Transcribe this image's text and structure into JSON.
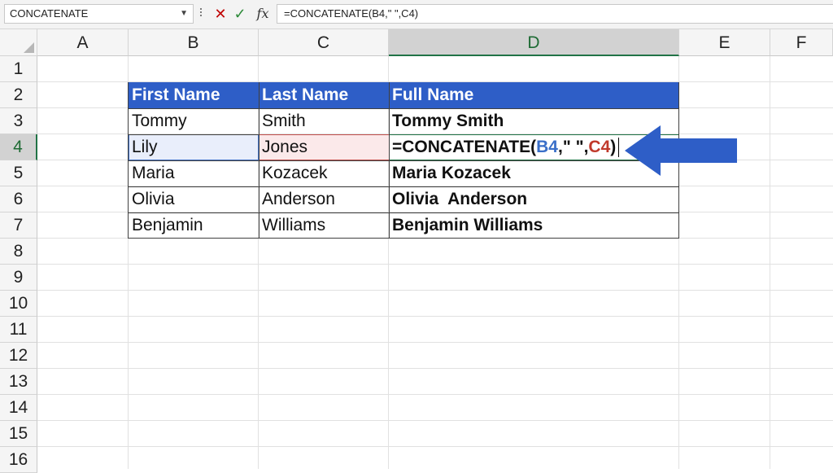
{
  "name_box": {
    "value": "CONCATENATE"
  },
  "formula_bar": {
    "cancel_glyph": "✕",
    "enter_glyph": "✓",
    "fx_label": "fx",
    "formula": "=CONCATENATE(B4,\" \",C4)"
  },
  "columns": [
    "A",
    "B",
    "C",
    "D",
    "E",
    "F"
  ],
  "active_column": "D",
  "rows": [
    "1",
    "2",
    "3",
    "4",
    "5",
    "6",
    "7",
    "8",
    "9",
    "10",
    "11",
    "12",
    "13",
    "14",
    "15",
    "16"
  ],
  "active_row": "4",
  "table": {
    "headers": [
      "First Name",
      "Last Name",
      "Full Name"
    ],
    "rows": [
      {
        "first": "Tommy",
        "last": "Smith",
        "full": "Tommy Smith"
      },
      {
        "first": "Lily",
        "last": "Jones",
        "full": ""
      },
      {
        "first": "Maria",
        "last": "Kozacek",
        "full": "Maria Kozacek"
      },
      {
        "first": "Olivia",
        "last": "Anderson",
        "full": "Olivia  Anderson"
      },
      {
        "first": "Benjamin",
        "last": "Williams",
        "full": "Benjamin Williams"
      }
    ]
  },
  "editing_cell": {
    "prefix": "=CONCATENATE(",
    "ref1": "B4",
    "middle": ",\" \",",
    "ref2": "C4",
    "suffix": ")"
  },
  "colors": {
    "header_fill": "#2e5ec7",
    "arrow": "#2e5ec7",
    "ref1": "#3a6fc8",
    "ref2": "#c0392b",
    "accent": "#217346"
  }
}
